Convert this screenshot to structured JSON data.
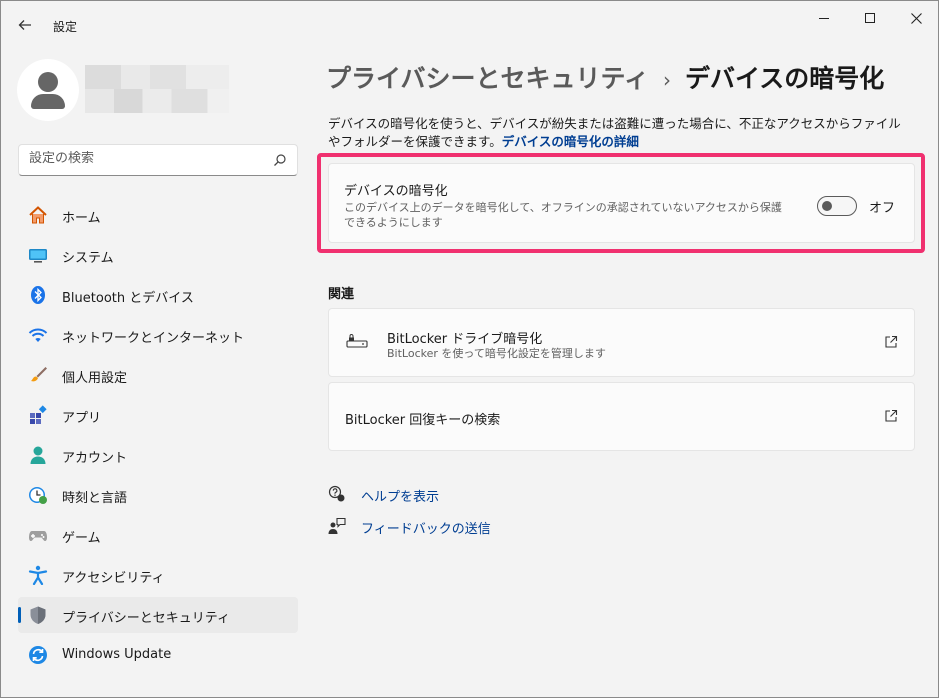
{
  "window": {
    "title": "設定"
  },
  "search": {
    "placeholder": "設定の検索"
  },
  "sidebar": {
    "items": [
      {
        "label": "ホーム",
        "icon": "home-icon"
      },
      {
        "label": "システム",
        "icon": "system-icon"
      },
      {
        "label": "Bluetooth とデバイス",
        "icon": "bluetooth-icon"
      },
      {
        "label": "ネットワークとインターネット",
        "icon": "wifi-icon"
      },
      {
        "label": "個人用設定",
        "icon": "brush-icon"
      },
      {
        "label": "アプリ",
        "icon": "apps-icon"
      },
      {
        "label": "アカウント",
        "icon": "account-icon"
      },
      {
        "label": "時刻と言語",
        "icon": "time-language-icon"
      },
      {
        "label": "ゲーム",
        "icon": "gamepad-icon"
      },
      {
        "label": "アクセシビリティ",
        "icon": "accessibility-icon"
      },
      {
        "label": "プライバシーとセキュリティ",
        "icon": "shield-icon",
        "active": true
      },
      {
        "label": "Windows Update",
        "icon": "update-icon"
      }
    ]
  },
  "main": {
    "breadcrumb": {
      "parent": "プライバシーとセキュリティ",
      "separator": "›",
      "current": "デバイスの暗号化"
    },
    "description": "デバイスの暗号化を使うと、デバイスが紛失または盗難に遭った場合に、不正なアクセスからファイルやフォルダーを保護できます。",
    "description_link": "デバイスの暗号化の詳細",
    "encryption_card": {
      "title": "デバイスの暗号化",
      "subtitle": "このデバイス上のデータを暗号化して、オフラインの承認されていないアクセスから保護できるようにします",
      "toggle_state": "オフ"
    },
    "related": {
      "heading": "関連",
      "bitlocker": {
        "title": "BitLocker ドライブ暗号化",
        "subtitle": "BitLocker を使って暗号化設定を管理します"
      },
      "recovery": {
        "title": "BitLocker 回復キーの検索"
      }
    },
    "links": {
      "help": "ヘルプを表示",
      "feedback": "フィードバックの送信"
    }
  },
  "colors": {
    "accent": "#005fb8",
    "link": "#003e92",
    "highlight": "#f0306f"
  }
}
